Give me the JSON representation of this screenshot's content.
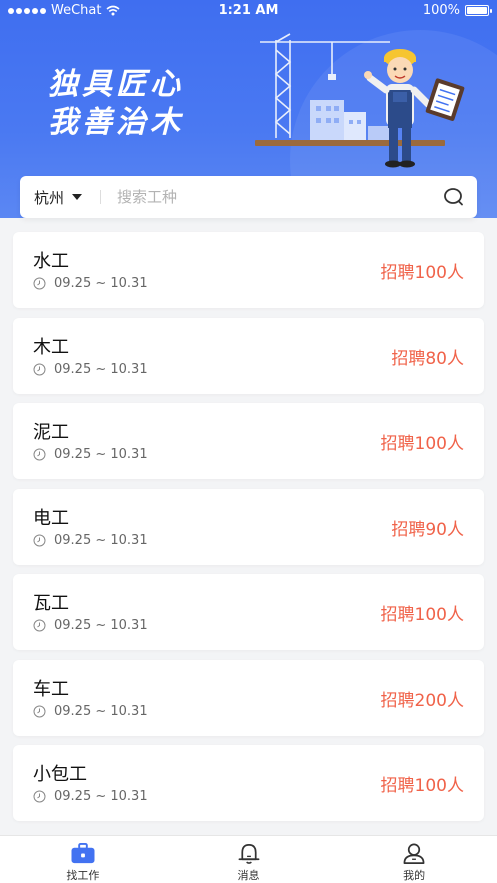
{
  "status_bar": {
    "carrier": "WeChat",
    "time": "1:21 AM",
    "battery": "100%"
  },
  "hero": {
    "slogan_line1": "独具匠心",
    "slogan_line2": "我善治木"
  },
  "search": {
    "city": "杭州",
    "placeholder": "搜索工种"
  },
  "jobs": [
    {
      "title": "水工",
      "date": "09.25 ~ 10.31",
      "recruit": "招聘100人"
    },
    {
      "title": "木工",
      "date": "09.25 ~ 10.31",
      "recruit": "招聘80人"
    },
    {
      "title": "泥工",
      "date": "09.25 ~ 10.31",
      "recruit": "招聘100人"
    },
    {
      "title": "电工",
      "date": "09.25 ~ 10.31",
      "recruit": "招聘90人"
    },
    {
      "title": "瓦工",
      "date": "09.25 ~ 10.31",
      "recruit": "招聘100人"
    },
    {
      "title": "车工",
      "date": "09.25 ~ 10.31",
      "recruit": "招聘200人"
    },
    {
      "title": "小包工",
      "date": "09.25 ~ 10.31",
      "recruit": "招聘100人"
    }
  ],
  "tabs": [
    {
      "label": "找工作",
      "icon": "briefcase-icon",
      "active": true
    },
    {
      "label": "消息",
      "icon": "bell-icon",
      "active": false
    },
    {
      "label": "我的",
      "icon": "user-icon",
      "active": false
    }
  ],
  "colors": {
    "primary": "#4272f1",
    "recruit": "#f0634a"
  }
}
